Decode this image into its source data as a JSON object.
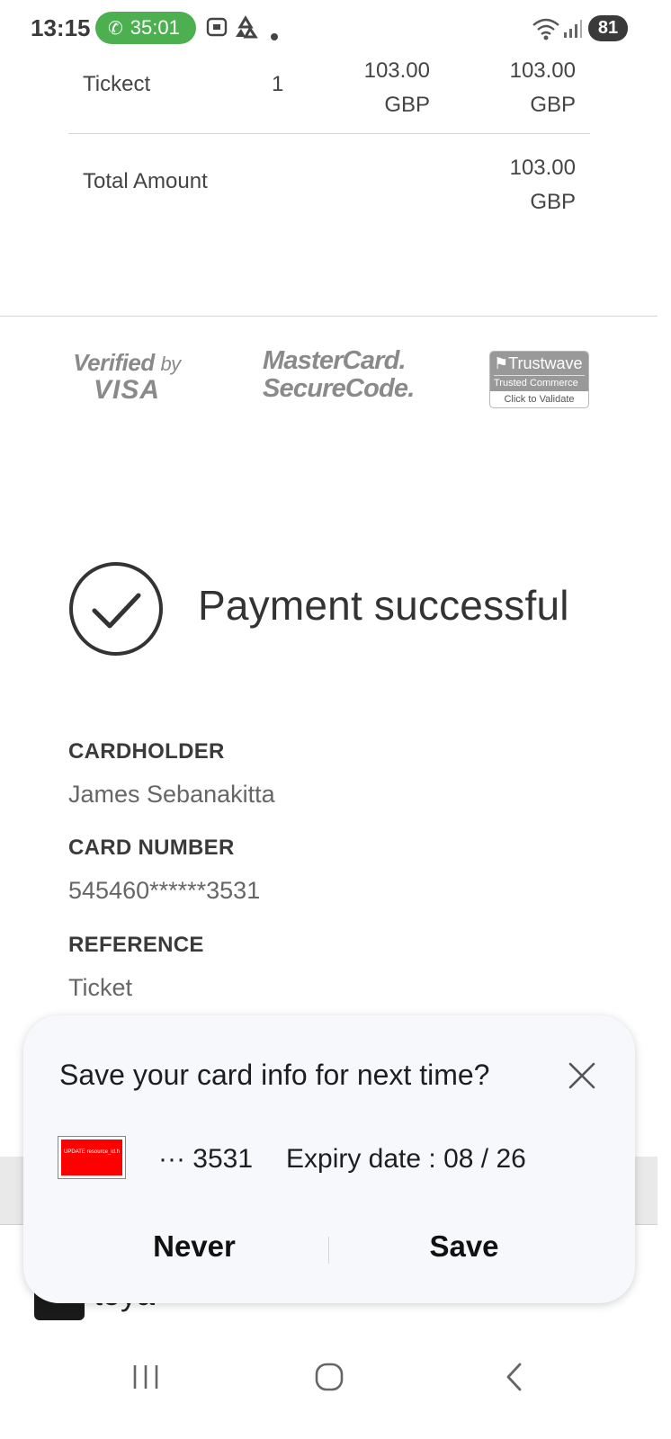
{
  "status_bar": {
    "time": "13:15",
    "call_timer": "35:01",
    "battery": "81",
    "icons": [
      "phone-icon",
      "screenshot-icon",
      "recycle-icon",
      "notification-dot-icon",
      "wifi-icon",
      "signal-icon"
    ]
  },
  "order": {
    "item_row": {
      "name": "Tickect",
      "qty": "1",
      "unit_price_amount": "103.00",
      "unit_price_currency": "GBP",
      "total_amount": "103.00",
      "total_currency": "GBP"
    },
    "total_row": {
      "label": "Total Amount",
      "amount": "103.00",
      "currency": "GBP"
    }
  },
  "security_logos": {
    "verified_by_visa": {
      "line1": "Verified",
      "by": "by",
      "line2": "VISA"
    },
    "mastercard_securecode": {
      "line1": "MasterCard.",
      "line2": "SecureCode."
    },
    "trustwave": {
      "brand": "Trustwave",
      "subtitle": "Trusted Commerce",
      "action": "Click to Validate"
    }
  },
  "result": {
    "title": "Payment successful",
    "icon": "check-circle-icon"
  },
  "details": {
    "cardholder_label": "CARDHOLDER",
    "cardholder_value": "James Sebanakitta",
    "card_number_label": "CARD NUMBER",
    "card_number_value": "545460******3531",
    "reference_label": "REFERENCE",
    "reference_value": "Ticket"
  },
  "app_bar": {
    "name": "toya"
  },
  "save_card_sheet": {
    "title": "Save your card info for next time?",
    "card_thumb_text": "UPDATE resource_id.h",
    "card_digits": "··· 3531",
    "expiry": "Expiry date : 08 / 26",
    "never_label": "Never",
    "save_label": "Save"
  },
  "nav_bar": {
    "icons": [
      "recent-apps-icon",
      "home-icon",
      "back-icon"
    ]
  },
  "colors": {
    "call_pill": "#4caf50",
    "text_primary": "#333333",
    "sheet_bg": "#f7f8fc"
  }
}
